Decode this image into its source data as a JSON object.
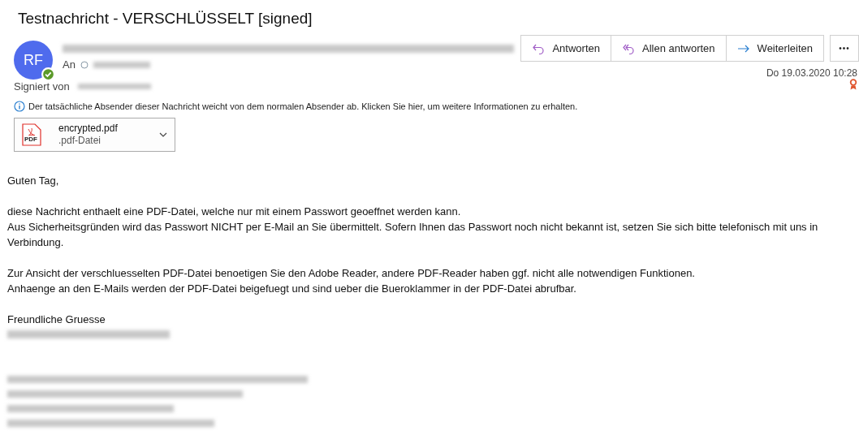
{
  "subject": "Testnachricht - VERSCHLÜSSELT [signed]",
  "sender": {
    "initials": "RF",
    "verified": true,
    "to_label": "An",
    "signed_by_label": "Signiert von"
  },
  "actions": [
    {
      "kind": "reply",
      "label": "Antworten"
    },
    {
      "kind": "reply_all",
      "label": "Allen antworten"
    },
    {
      "kind": "forward",
      "label": "Weiterleiten"
    },
    {
      "kind": "more",
      "label": "•••"
    }
  ],
  "date": "Do 19.03.2020 10:28",
  "notice": "Der tatsächliche Absender dieser Nachricht weicht von dem normalen Absender ab. Klicken Sie hier, um weitere Informationen zu erhalten.",
  "attachment": {
    "name": "encrypted.pdf",
    "type": ".pdf-Datei",
    "icon_label": "PDF"
  },
  "body": [
    [
      "Guten Tag,"
    ],
    [
      "diese Nachricht enthaelt eine PDF-Datei, welche nur mit einem Passwort geoeffnet werden kann.",
      "Aus Sicherheitsgründen wird das Passwort NICHT per E-Mail an Sie übermittelt. Sofern Ihnen das Passwort noch nicht bekannt ist, setzen Sie sich bitte telefonisch mit uns in Verbindung."
    ],
    [
      "Zur Ansicht der verschluesselten PDF-Datei benoetigen Sie den Adobe Reader, andere PDF-Reader haben ggf. nicht alle notwendigen Funktionen.",
      "Anhaenge an den E-Mails werden der PDF-Datei beigefuegt und sind ueber die Bueroklammer in der PDF-Datei abrufbar."
    ],
    [
      "Freundliche Gruesse"
    ]
  ]
}
